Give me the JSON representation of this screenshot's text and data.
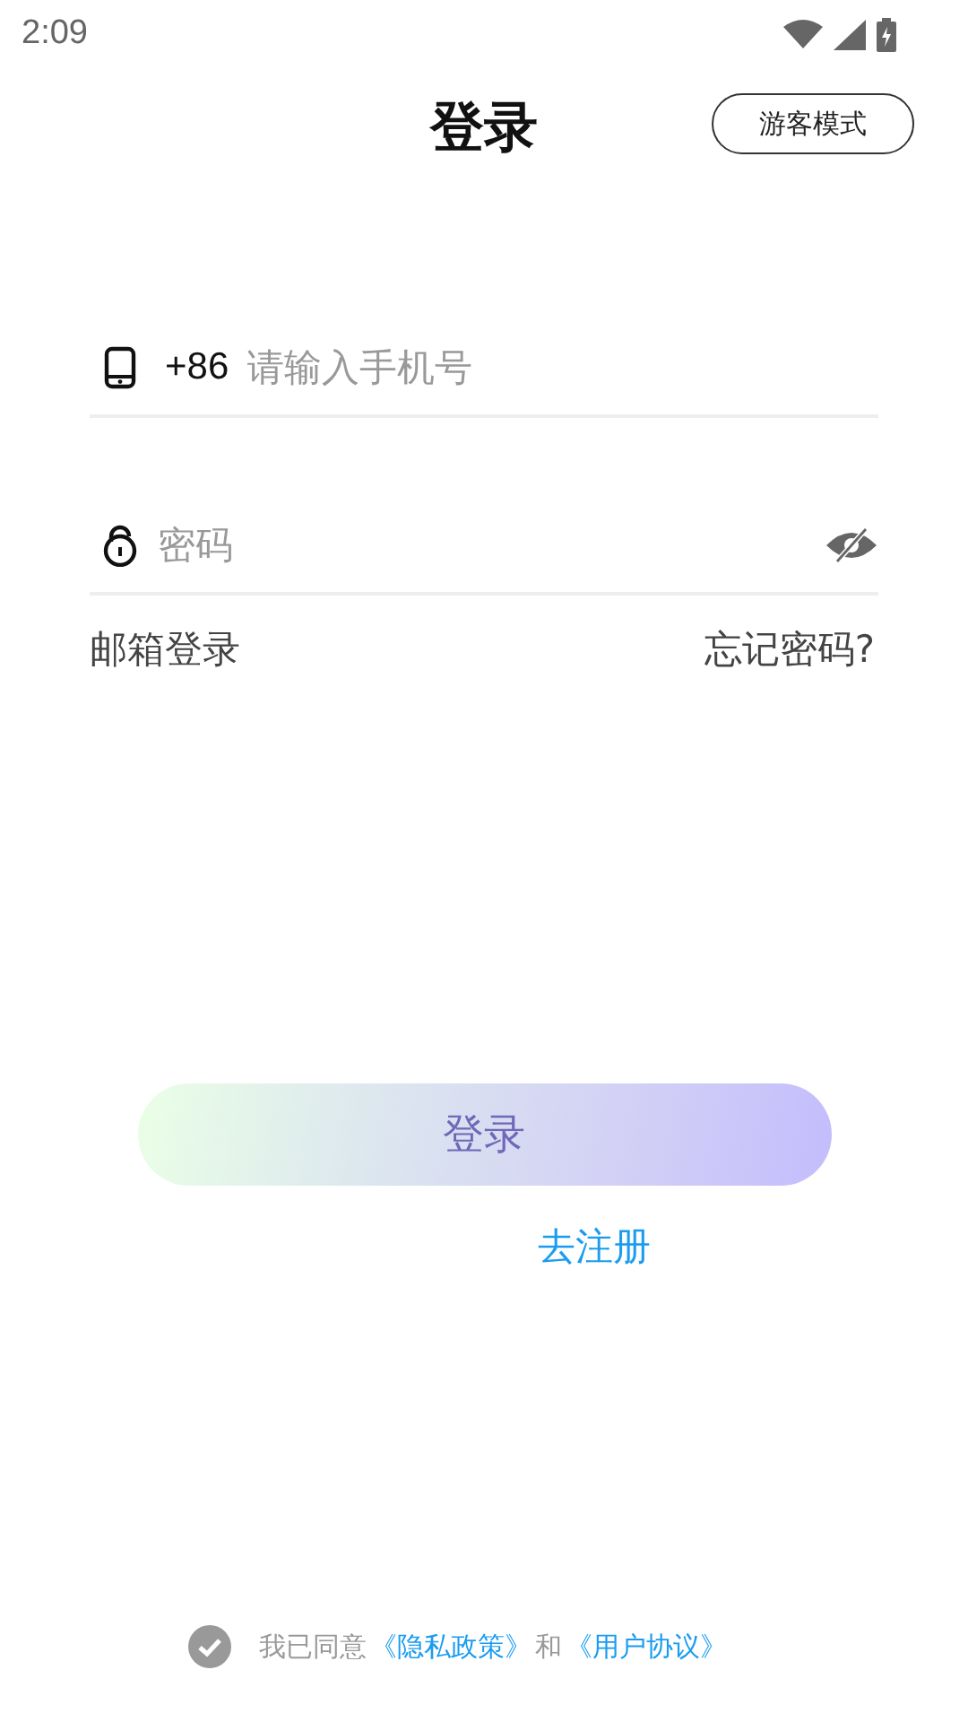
{
  "status_bar": {
    "time": "2:09"
  },
  "header": {
    "title": "登录",
    "guest_button": "游客模式"
  },
  "phone_field": {
    "prefix": "+86",
    "placeholder": "请输入手机号"
  },
  "password_field": {
    "placeholder": "密码",
    "password_visible": false
  },
  "links": {
    "email_login": "邮箱登录",
    "forgot_password": "忘记密码?"
  },
  "login_button": "登录",
  "register_link": "去注册",
  "agreement": {
    "checked": false,
    "text": "我已同意",
    "privacy_link": "《隐私政策》",
    "and": "和",
    "terms_link": "《用户协议》"
  }
}
